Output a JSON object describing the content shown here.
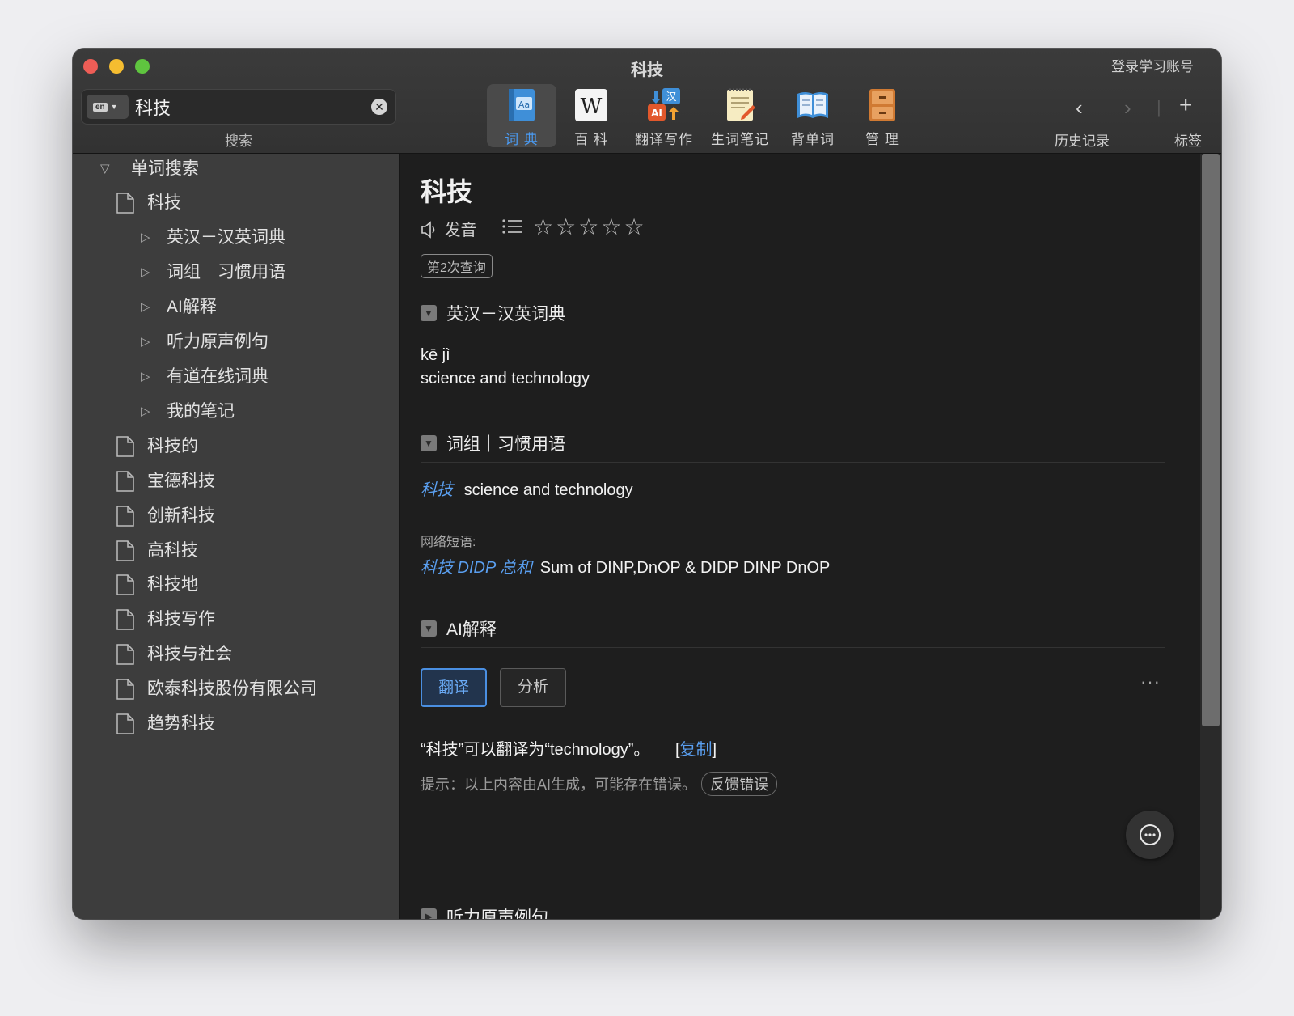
{
  "window": {
    "title": "科技"
  },
  "account": {
    "login_label": "登录学习账号"
  },
  "search": {
    "value": "科技",
    "label": "搜索",
    "lang": "en"
  },
  "toolbar": {
    "tools": [
      {
        "label": "词 典",
        "icon": "dictionary-book-icon",
        "active": true
      },
      {
        "label": "百 科",
        "icon": "wikipedia-icon",
        "active": false
      },
      {
        "label": "翻译写作",
        "icon": "ai-translate-icon",
        "active": false
      },
      {
        "label": "生词笔记",
        "icon": "notebook-icon",
        "active": false
      },
      {
        "label": "背单词",
        "icon": "flashcard-book-icon",
        "active": false
      },
      {
        "label": "管 理",
        "icon": "cabinet-icon",
        "active": false
      }
    ],
    "history_label": "历史记录",
    "tags_label": "标签"
  },
  "sidebar": {
    "root_label": "单词搜索",
    "current_word": "科技",
    "sections": [
      "英汉－汉英词典",
      "词组｜习惯用语",
      "AI解释",
      "听力原声例句",
      "有道在线词典",
      "我的笔记"
    ],
    "related_words": [
      "科技的",
      "宝德科技",
      "创新科技",
      "高科技",
      "科技地",
      "科技写作",
      "科技与社会",
      "欧泰科技股份有限公司",
      "趋势科技"
    ]
  },
  "entry": {
    "word": "科技",
    "pronounce_label": "发音",
    "rating_stars": 0,
    "query_count_badge": "第2次查询",
    "dict_section": {
      "title": "英汉－汉英词典",
      "pinyin": "kē jì",
      "definition": "science and technology"
    },
    "phrase_section": {
      "title": "词组｜习惯用语",
      "phrase": "科技",
      "phrase_meaning": "science and technology",
      "web_label": "网络短语:",
      "web_phrase": "科技 DIDP 总和",
      "web_meaning": "Sum of DINP,DnOP & DIDP DINP DnOP"
    },
    "ai_section": {
      "title": "AI解释",
      "tab_translate": "翻译",
      "tab_analyze": "分析",
      "more": "···",
      "result": "“科技”可以翻译为“technology”。",
      "copy_open": "[",
      "copy_label": "复制",
      "copy_close": "]",
      "hint": "提示：以上内容由AI生成，可能存在错误。",
      "feedback_label": "反馈错误"
    },
    "listening_section": {
      "title": "听力原声例句"
    }
  },
  "colors": {
    "accent": "#4a9cf5",
    "link": "#5a9ff0",
    "sidebar_bg": "#3d3d3d",
    "content_bg": "#1e1e1e"
  }
}
